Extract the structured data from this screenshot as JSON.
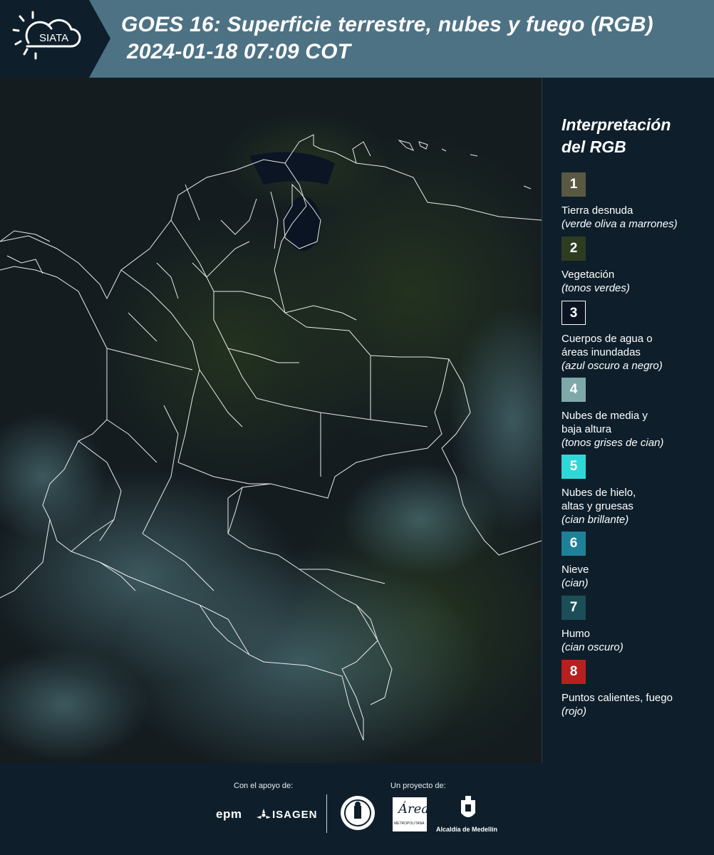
{
  "header": {
    "logo_text": "SIATA",
    "title_line1": "GOES 16: Superficie terrestre, nubes y fuego (RGB)",
    "title_line2": "2024-01-18 07:09 COT"
  },
  "legend": {
    "title_line1": "Interpretación",
    "title_line2": "del RGB",
    "items": [
      {
        "num": "1",
        "label": "Tierra desnuda",
        "sub": "(verde oliva a marrones)",
        "color": "#595842"
      },
      {
        "num": "2",
        "label": "Vegetación",
        "sub": "(tonos verdes)",
        "color": "#2e3d22"
      },
      {
        "num": "3",
        "label": "Cuerpos de agua o",
        "label2": "áreas inundadas",
        "sub": "(azul oscuro a negro)",
        "color": "#0b1420"
      },
      {
        "num": "4",
        "label": "Nubes de media y",
        "label2": "baja altura",
        "sub": "(tonos grises de cian)",
        "color": "#7fa8a9"
      },
      {
        "num": "5",
        "label": "Nubes de hielo,",
        "label2": "altas y gruesas",
        "sub": "(cian brillante)",
        "color": "#2fd8d8"
      },
      {
        "num": "6",
        "label": "Nieve",
        "sub": "(cian)",
        "color": "#1f8197"
      },
      {
        "num": "7",
        "label": "Humo",
        "sub": "(cian oscuro)",
        "color": "#1c4e58"
      },
      {
        "num": "8",
        "label": "Puntos calientes, fuego",
        "sub": "(rojo)",
        "color": "#b81f1f"
      }
    ]
  },
  "footer": {
    "support_label": "Con el apoyo de:",
    "project_label": "Un proyecto de:",
    "sponsor1": "epm",
    "sponsor2": "ISAGEN",
    "org_area_line1": "Área",
    "org_area_line2": "METROPOLITANA",
    "org_alcaldia": "Alcaldía de Medellín"
  },
  "colors": {
    "header_bg": "#4d7284",
    "page_bg": "#0e1f2b",
    "map_bg": "#121a1e",
    "borders": "#ffffff"
  }
}
